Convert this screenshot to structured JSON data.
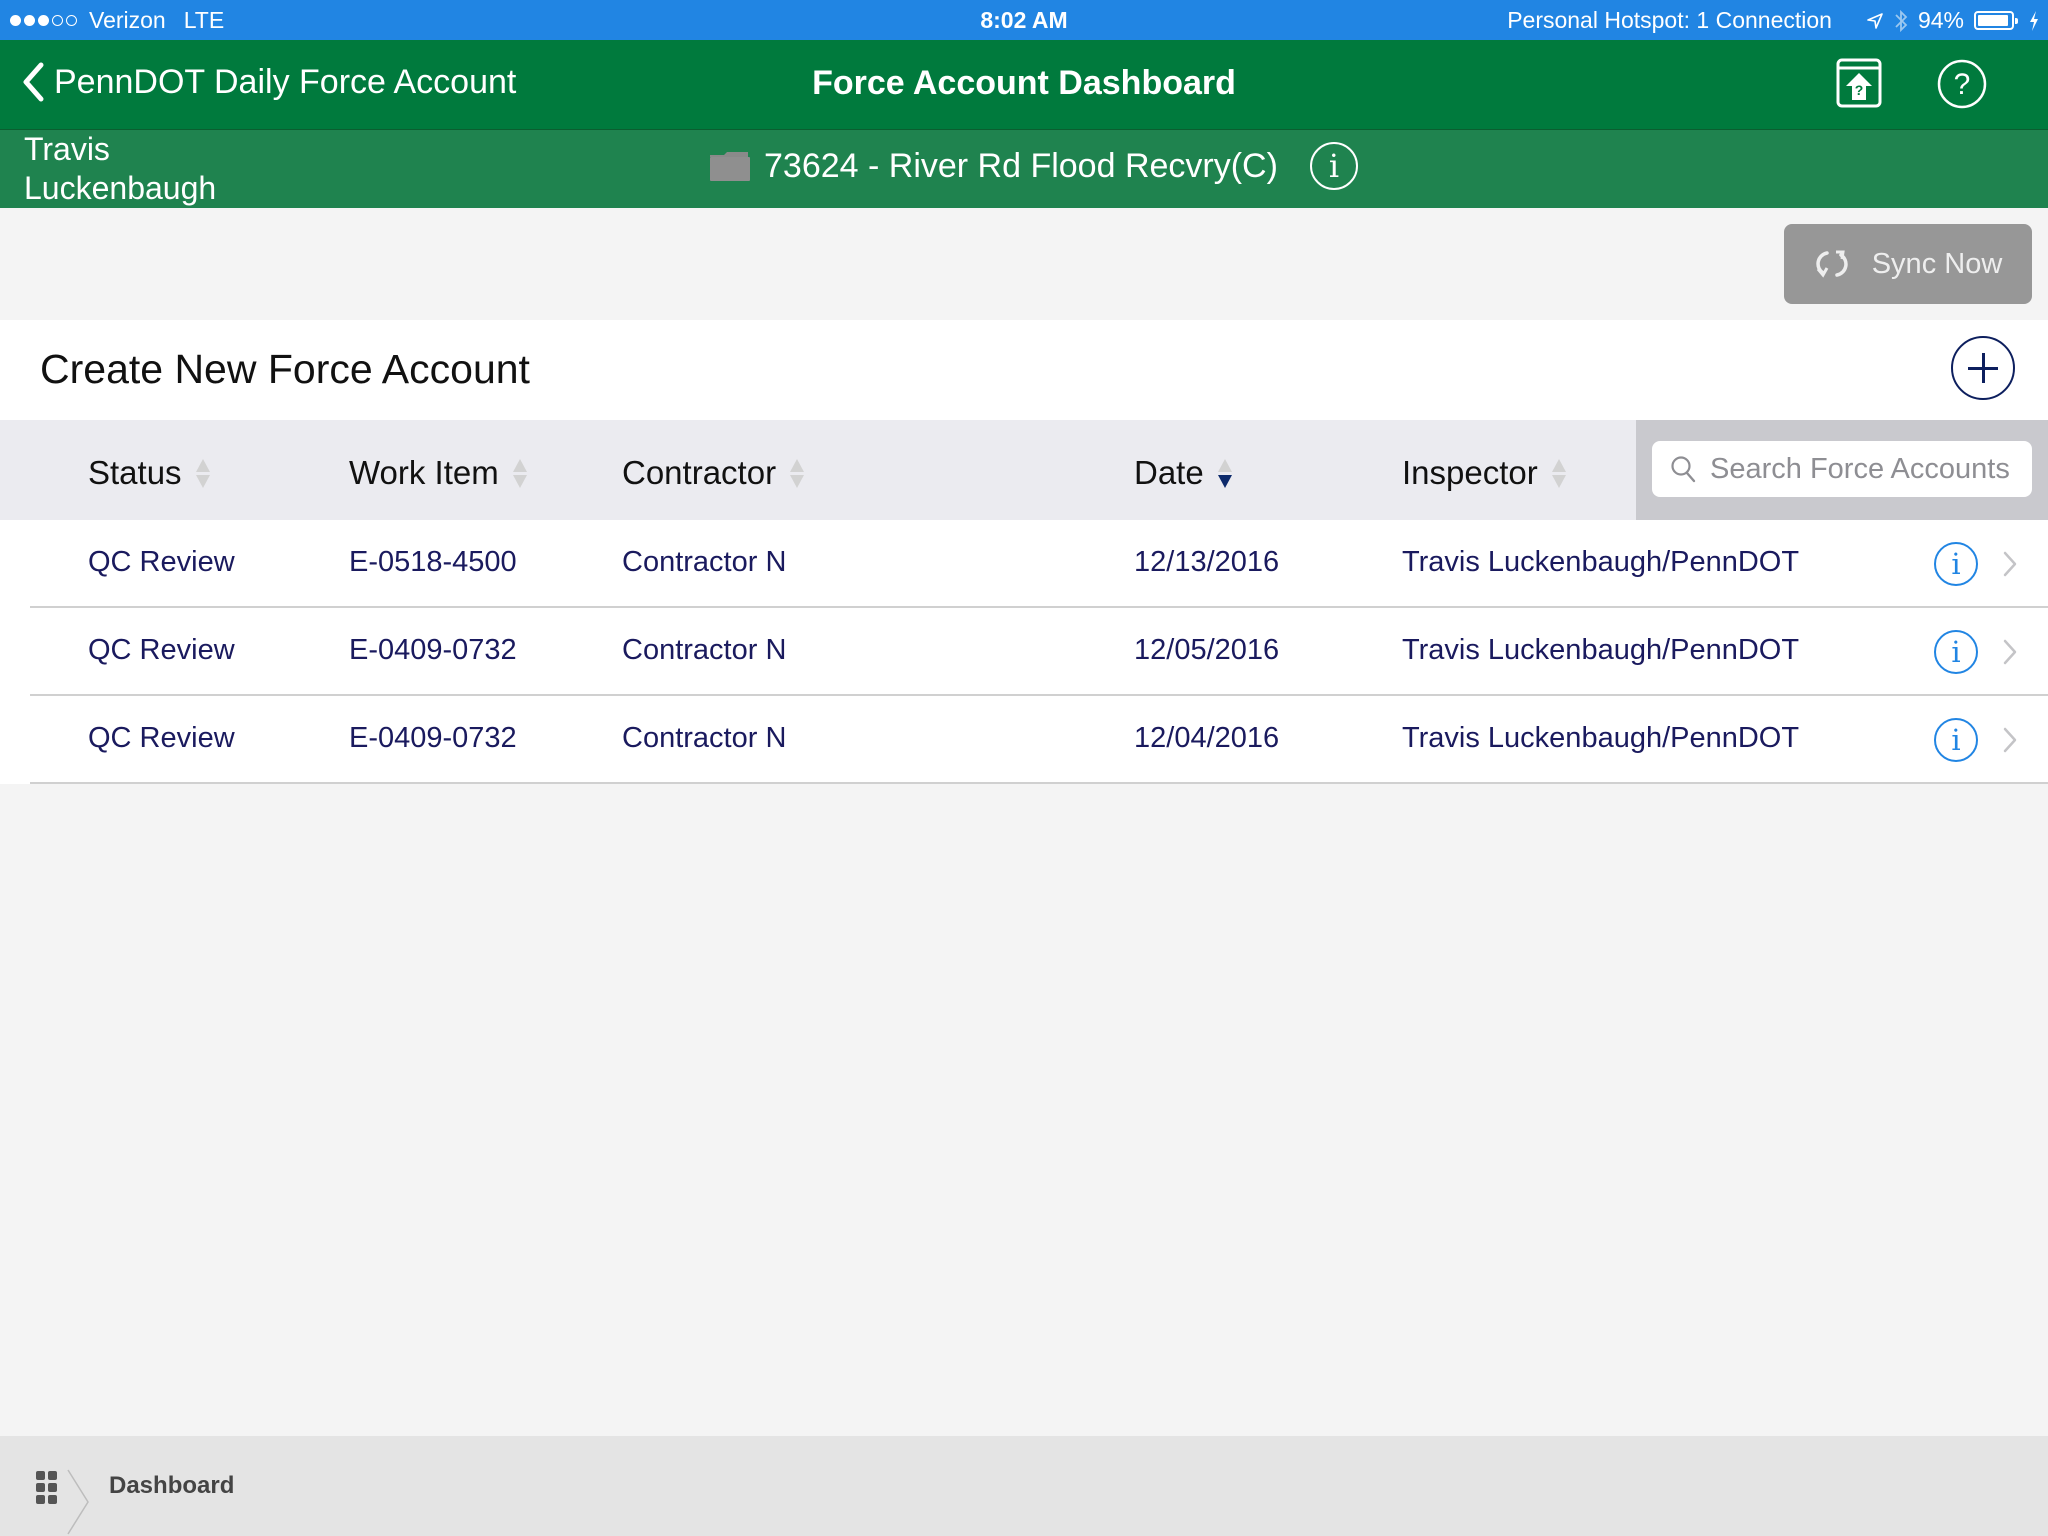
{
  "status_bar": {
    "signal_filled": 3,
    "signal_total": 5,
    "carrier": "Verizon",
    "network": "LTE",
    "time": "8:02 AM",
    "hotspot": "Personal Hotspot: 1 Connection",
    "battery_percent": "94%",
    "battery_level": 0.94,
    "icons": [
      "location-icon",
      "bluetooth-icon",
      "battery-icon",
      "charging-icon"
    ]
  },
  "navbar": {
    "back_label": "PennDOT Daily Force Account",
    "title": "Force Account Dashboard",
    "icons": [
      "help-home-icon",
      "help-icon"
    ]
  },
  "subheader": {
    "user_name": "Travis Luckenbaugh",
    "project": "73624 - River Rd Flood Recvry(C)",
    "info_glyph": "i"
  },
  "sync": {
    "label": "Sync Now"
  },
  "create": {
    "title": "Create New Force Account"
  },
  "table": {
    "columns": [
      {
        "label": "Status",
        "sort": "none"
      },
      {
        "label": "Work Item",
        "sort": "none"
      },
      {
        "label": "Contractor",
        "sort": "none"
      },
      {
        "label": "Date",
        "sort": "descending"
      },
      {
        "label": "Inspector",
        "sort": "none"
      }
    ],
    "search_placeholder": "Search Force Accounts",
    "search_value": "",
    "rows": [
      {
        "status": "QC Review",
        "work_item": "E-0518-4500",
        "contractor": "Contractor N",
        "date": "12/13/2016",
        "inspector": "Travis Luckenbaugh/PennDOT"
      },
      {
        "status": "QC Review",
        "work_item": "E-0409-0732",
        "contractor": "Contractor N",
        "date": "12/05/2016",
        "inspector": "Travis Luckenbaugh/PennDOT"
      },
      {
        "status": "QC Review",
        "work_item": "E-0409-0732",
        "contractor": "Contractor N",
        "date": "12/04/2016",
        "inspector": "Travis Luckenbaugh/PennDOT"
      }
    ],
    "info_glyph": "i"
  },
  "bottombar": {
    "breadcrumb": "Dashboard"
  },
  "colors": {
    "status_bar": "#2185e3",
    "navbar": "#007a3d",
    "subheader": "#1f834f",
    "row_text": "#1a1a5e",
    "accent_blue": "#2185e3",
    "sort_active": "#0d2a6b"
  }
}
